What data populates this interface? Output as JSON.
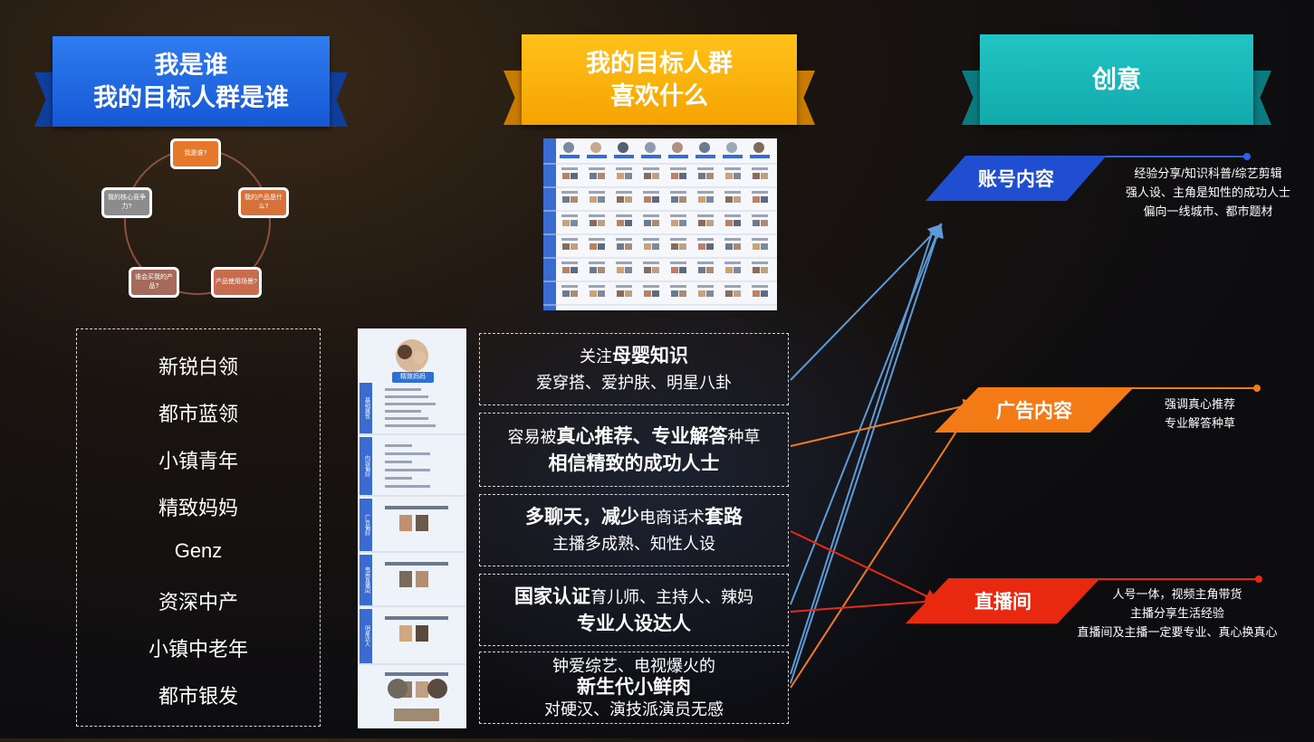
{
  "banners": {
    "left": {
      "line1": "我是谁",
      "line2": "我的目标人群是谁"
    },
    "middle": {
      "line1": "我的目标人群",
      "line2": "喜欢什么"
    },
    "right": {
      "line1": "创意"
    }
  },
  "cycle": {
    "nodes": [
      "我是谁?",
      "我的产品是什么?",
      "产品使用场景?",
      "谁会买我的产品?",
      "我的核心竞争力?"
    ]
  },
  "audiences": [
    "新锐白领",
    "都市蓝领",
    "小镇青年",
    "精致妈妈",
    "Genz",
    "资深中产",
    "小镇中老年",
    "都市银发"
  ],
  "profile_card": {
    "name": "精致妈妈",
    "rows": [
      "基础属性",
      "内容偏好",
      "广告偏好",
      "电商直播间",
      "明星达人"
    ]
  },
  "preferences": [
    {
      "lines": [
        [
          {
            "t": "关注",
            "b": false
          },
          {
            "t": "母婴知识",
            "b": true
          }
        ],
        [
          {
            "t": "爱穿搭、爱护肤、明星八卦",
            "b": false
          }
        ]
      ]
    },
    {
      "lines": [
        [
          {
            "t": "容易被",
            "b": false
          },
          {
            "t": "真心推荐、专业解答",
            "b": true
          },
          {
            "t": "种草",
            "b": false
          }
        ],
        [
          {
            "t": "相信精致的成功人士",
            "b": true
          }
        ]
      ]
    },
    {
      "lines": [
        [
          {
            "t": "多聊天，减少",
            "b": true
          },
          {
            "t": "电商话术",
            "b": false
          },
          {
            "t": "套路",
            "b": true
          }
        ],
        [
          {
            "t": "主播多成熟、知性人设",
            "b": false
          }
        ]
      ]
    },
    {
      "lines": [
        [
          {
            "t": "国家认证",
            "b": true
          },
          {
            "t": "育儿师、主持人、辣妈",
            "b": false
          }
        ],
        [
          {
            "t": "专业人设达人",
            "b": true
          }
        ]
      ]
    },
    {
      "lines": [
        [
          {
            "t": "钟爱综艺、电视爆火的",
            "b": false
          }
        ],
        [
          {
            "t": "新生代小鲜肉",
            "b": true
          }
        ],
        [
          {
            "t": "对硬汉、演技派演员无感",
            "b": false
          }
        ]
      ]
    }
  ],
  "outputs": [
    {
      "label": "账号内容",
      "color": "#1f4fd0",
      "line_color": "#2b63e6",
      "desc": [
        "经验分享/知识科普/综艺剪辑",
        "强人设、主角是知性的成功人士",
        "偏向一线城市、都市题材"
      ]
    },
    {
      "label": "广告内容",
      "color": "#f47a16",
      "line_color": "#f47a16",
      "desc": [
        "强调真心推荐",
        "专业解答种草"
      ]
    },
    {
      "label": "直播间",
      "color": "#e8290f",
      "line_color": "#e8290f",
      "desc": [
        "人号一体，视频主角带货",
        "主播分享生活经验",
        "直播间及主播一定要专业、真心换真心"
      ]
    }
  ]
}
